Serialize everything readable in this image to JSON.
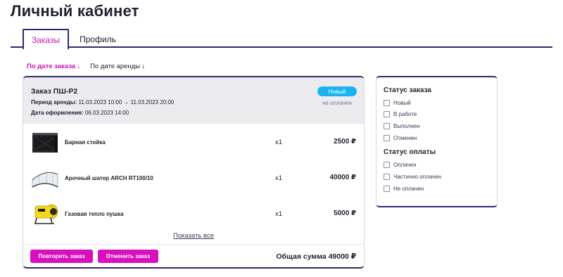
{
  "page": {
    "title": "Личный кабинет"
  },
  "tabs": [
    {
      "label": "Заказы",
      "active": true
    },
    {
      "label": "Профиль",
      "active": false
    }
  ],
  "sort": {
    "by_order_date": "По дате заказа",
    "by_rent_date": "По дате аренды",
    "arrow_icon": "↓"
  },
  "order": {
    "title": "Заказ ПШ-Р2",
    "status": "Новый",
    "payment_status": "не оплачен",
    "period_label": "Период аренды:",
    "period_value": "11.03.2023 10:00 → 11.03.2023 20:00",
    "created_label": "Дата оформления:",
    "created_value": "06.03.2023 14:00",
    "items": [
      {
        "name": "Барная стойка",
        "qty": "x1",
        "price": "2500 ₽",
        "icon": "bar-counter-image"
      },
      {
        "name": "Арочный шатер ARCH RT100/10",
        "qty": "x1",
        "price": "40000 ₽",
        "icon": "tent-image"
      },
      {
        "name": "Газовая тепло пушка",
        "qty": "x1",
        "price": "5000 ₽",
        "icon": "heat-gun-image"
      }
    ],
    "show_all": "Показать все",
    "repeat_button": "Повторить заказ",
    "cancel_button": "Отменить заказ",
    "total": "Общая сумма 49000 ₽"
  },
  "filters": {
    "order_status": {
      "heading": "Статус заказа",
      "options": [
        "Новый",
        "В работе",
        "Выполнен",
        "Отменен"
      ]
    },
    "payment_status": {
      "heading": "Статус оплаты",
      "options": [
        "Оплачен",
        "Частично оплачен",
        "Не оплачен"
      ]
    }
  },
  "colors": {
    "accent": "#d80fbd",
    "badge": "#19b4f0",
    "border": "#2d2a6e"
  }
}
